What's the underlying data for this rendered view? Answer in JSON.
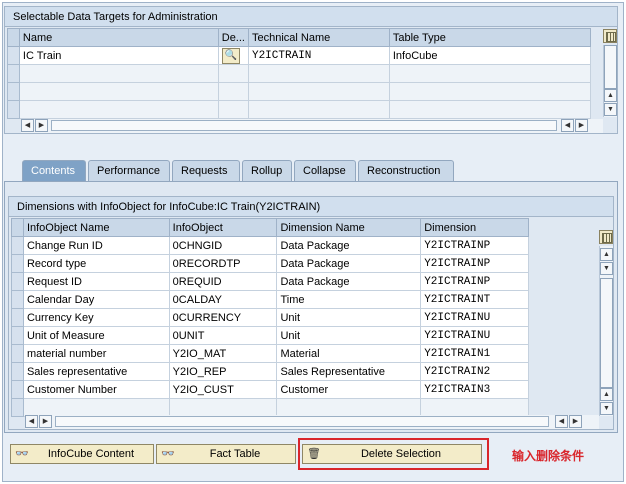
{
  "top_panel": {
    "title": "Selectable Data Targets for Administration",
    "columns": [
      "Name",
      "De...",
      "Technical Name",
      "Table Type"
    ],
    "rows": [
      {
        "name": "IC Train",
        "technical_name": "Y2ICTRAIN",
        "table_type": "InfoCube"
      }
    ]
  },
  "tabs": [
    "Contents",
    "Performance",
    "Requests",
    "Rollup",
    "Collapse",
    "Reconstruction"
  ],
  "dimensions_panel": {
    "title": "Dimensions with InfoObject for InfoCube:IC Train(Y2ICTRAIN)",
    "columns": [
      "InfoObject Name",
      "InfoObject",
      "Dimension Name",
      "Dimension"
    ],
    "rows": [
      {
        "name": "Change Run ID",
        "infoobject": "0CHNGID",
        "dim_name": "Data Package",
        "dim": "Y2ICTRAINP"
      },
      {
        "name": "Record type",
        "infoobject": "0RECORDTP",
        "dim_name": "Data Package",
        "dim": "Y2ICTRAINP"
      },
      {
        "name": "Request ID",
        "infoobject": "0REQUID",
        "dim_name": "Data Package",
        "dim": "Y2ICTRAINP"
      },
      {
        "name": "Calendar Day",
        "infoobject": "0CALDAY",
        "dim_name": "Time",
        "dim": "Y2ICTRAINT"
      },
      {
        "name": "Currency Key",
        "infoobject": "0CURRENCY",
        "dim_name": "Unit",
        "dim": "Y2ICTRAINU"
      },
      {
        "name": "Unit of Measure",
        "infoobject": "0UNIT",
        "dim_name": "Unit",
        "dim": "Y2ICTRAINU"
      },
      {
        "name": "material number",
        "infoobject": "Y2IO_MAT",
        "dim_name": "Material",
        "dim": "Y2ICTRAIN1"
      },
      {
        "name": "Sales representative",
        "infoobject": "Y2IO_REP",
        "dim_name": "Sales Representative",
        "dim": "Y2ICTRAIN2"
      },
      {
        "name": "Customer Number",
        "infoobject": "Y2IO_CUST",
        "dim_name": "Customer",
        "dim": "Y2ICTRAIN3"
      }
    ]
  },
  "buttons": {
    "infocube_content": "InfoCube Content",
    "fact_table": "Fact Table",
    "delete_selection": "Delete Selection"
  },
  "annotation": "输入删除条件",
  "icons": {
    "column_settings": "column-settings-icon",
    "details": "magnifier-icon",
    "glasses": "glasses-icon",
    "trash": "trash-icon"
  },
  "colors": {
    "highlight": "#d9262c",
    "active_tab": "#7fa2c6",
    "button_face": "#f3ecc9"
  }
}
